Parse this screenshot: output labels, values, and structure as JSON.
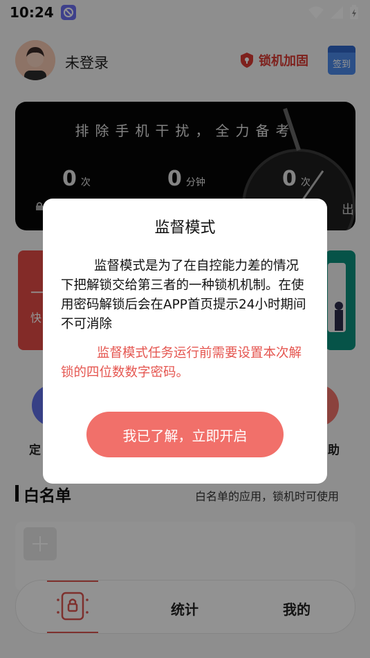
{
  "status_bar": {
    "time": "10:24"
  },
  "header": {
    "login_status": "未登录",
    "lock_reinforce_label": "锁机加固",
    "signin_label": "签到"
  },
  "banner": {
    "slogan": "排除手机干扰，全力备考",
    "stats": [
      {
        "value": "0",
        "unit": "次"
      },
      {
        "value": "0",
        "unit": "分钟"
      },
      {
        "value": "0",
        "unit": "次"
      }
    ],
    "partial_right_text": "出"
  },
  "features": {
    "red_card_char": "一",
    "red_card_partial": "快",
    "left_partial_label": "定",
    "right_partial_label": "助"
  },
  "whitelist": {
    "title": "白名单",
    "note": "白名单的应用，锁机时可使用"
  },
  "bottom_nav": {
    "stats_label": "统计",
    "mine_label": "我的"
  },
  "dialog": {
    "title": "监督模式",
    "body": "监督模式是为了在自控能力差的情况下把解锁交给第三者的一种锁机机制。在使用密码解锁后会在APP首页提示24小时期间不可消除",
    "warning": "监督模式任务运行前需要设置本次解锁的四位数数字密码。",
    "confirm_label": "我已了解，立即开启"
  },
  "colors": {
    "accent_red": "#f1706a",
    "warning_red": "#e55650",
    "brand_red": "#d93a33",
    "teal": "#0c8f7c",
    "blue": "#4a88e8"
  }
}
